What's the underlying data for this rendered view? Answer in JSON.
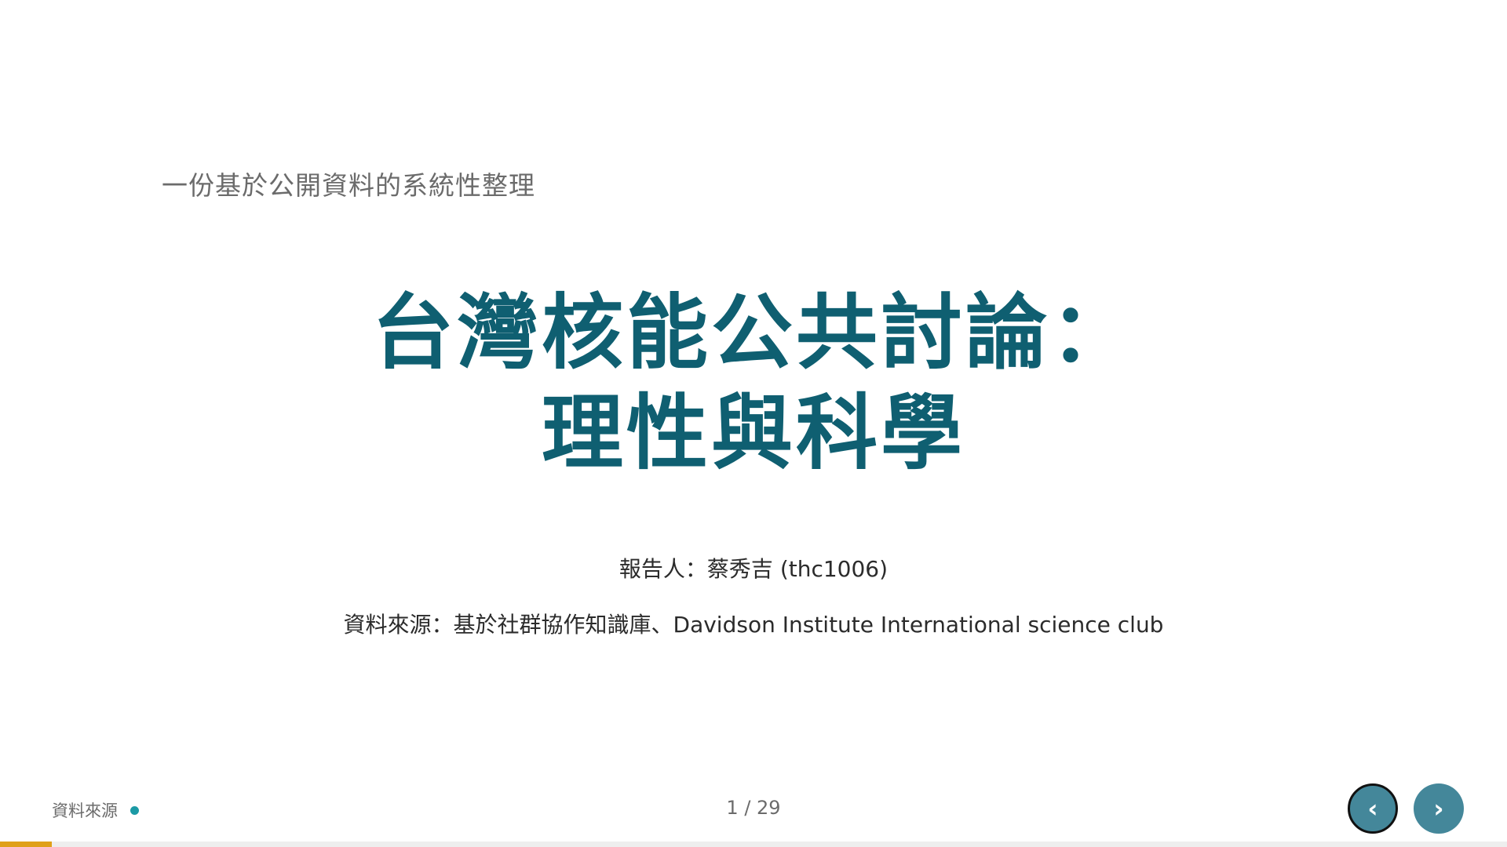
{
  "slide": {
    "subtitle": "一份基於公開資料的系統性整理",
    "title_line1": "台灣核能公共討論：",
    "title_line2": "理性與科學",
    "presenter": "報告人：蔡秀吉 (thc1006)",
    "source": "資料來源：基於社群協作知識庫、Davidson Institute International science club"
  },
  "footer": {
    "source_link": "資料來源",
    "page_counter": "1 / 29",
    "prev_label": "‹",
    "next_label": "›",
    "progress_fraction": 0.0345
  },
  "colors": {
    "title": "#0f5f71",
    "accent_dot": "#1b9aa5",
    "nav_button": "#44879a",
    "progress": "#e0a019"
  }
}
